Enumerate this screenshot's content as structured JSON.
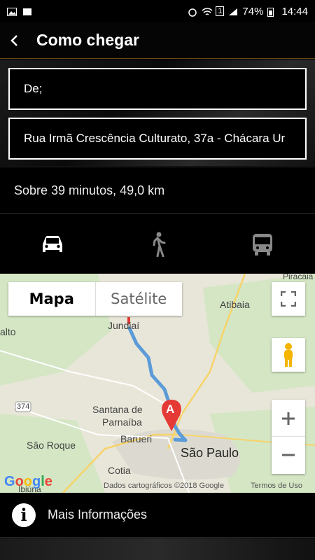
{
  "status_bar": {
    "battery": "74%",
    "time": "14:44",
    "sim": "1"
  },
  "app_bar": {
    "title": "Como chegar"
  },
  "route": {
    "from_value": "De;",
    "to_value": "Rua Irmã Crescência Culturato, 37a - Chácara Ur"
  },
  "summary": "Sobre 39 minutos, 49,0 km",
  "modes": [
    {
      "name": "car-icon",
      "selected": true
    },
    {
      "name": "walk-icon",
      "selected": false
    },
    {
      "name": "bus-icon",
      "selected": false
    }
  ],
  "map": {
    "type_map": "Mapa",
    "type_satellite": "Satélite",
    "labels": {
      "piracaia": "Piracaia",
      "atibaia": "Atibaia",
      "jundiai": "Jundiaí",
      "santana": "Santana de",
      "parnaiba": "Parnaíba",
      "barueri": "Barueri",
      "sao_paulo": "São Paulo",
      "sao_roque": "São Roque",
      "cotia": "Cotia",
      "ibiuna": "Ibiúna",
      "road_374": "374",
      "alto": "alto"
    },
    "marker": "A",
    "attribution": "Dados cartográficos ©2018 Google",
    "terms": "Termos de Uso",
    "logo": "Google"
  },
  "more_info": {
    "icon_letter": "i",
    "label": "Mais Informações"
  }
}
